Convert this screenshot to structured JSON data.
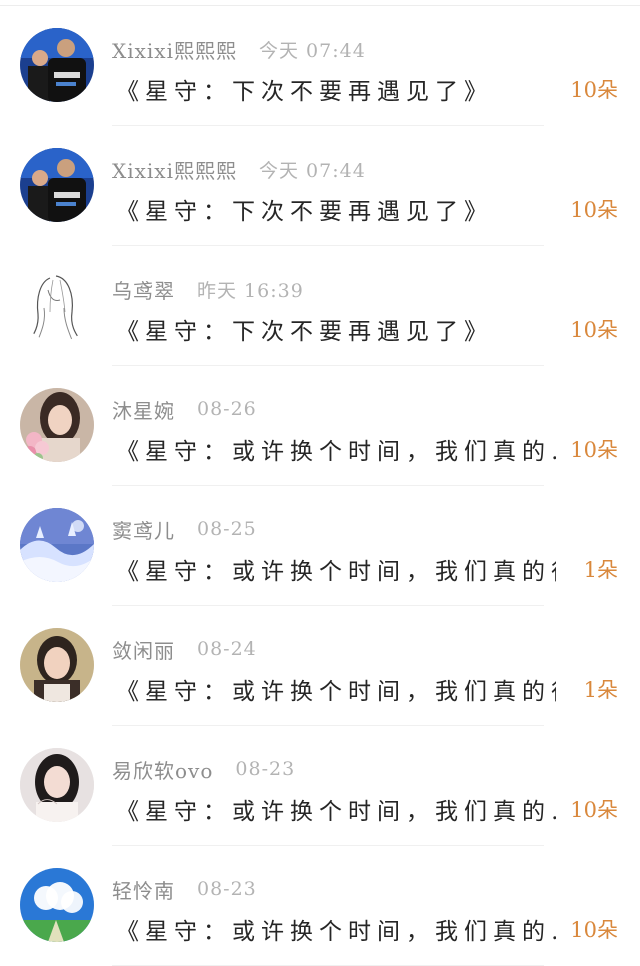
{
  "comments": [
    {
      "avatar_icon": "badminton-player-avatar",
      "username": "Xixixi熙熙熙",
      "time": "今天 07:44",
      "message": "《星守：下次不要再遇见了》",
      "count": "10朵"
    },
    {
      "avatar_icon": "badminton-player-avatar",
      "username": "Xixixi熙熙熙",
      "time": "今天 07:44",
      "message": "《星守：下次不要再遇见了》",
      "count": "10朵"
    },
    {
      "avatar_icon": "sketch-girl-avatar",
      "username": "乌鸢翠",
      "time": "昨天 16:39",
      "message": "《星守：下次不要再遇见了》",
      "count": "10朵"
    },
    {
      "avatar_icon": "girl-with-flowers-avatar",
      "username": "沐星婉",
      "time": "08-26",
      "message": "《星守：或许换个时间，我们真的…",
      "count": "10朵"
    },
    {
      "avatar_icon": "snowy-trees-avatar",
      "username": "窦鸢儿",
      "time": "08-25",
      "message": "《星守：或许换个时间，我们真的很…",
      "count": "1朵"
    },
    {
      "avatar_icon": "girl-portrait-avatar",
      "username": "敛闲丽",
      "time": "08-24",
      "message": "《星守：或许换个时间，我们真的很…",
      "count": "1朵"
    },
    {
      "avatar_icon": "dark-hair-girl-avatar",
      "username": "易欣软ovo",
      "time": "08-23",
      "message": "《星守：或许换个时间，我们真的…",
      "count": "10朵"
    },
    {
      "avatar_icon": "blue-sky-landscape-avatar",
      "username": "轻怜南",
      "time": "08-23",
      "message": "《星守：或许换个时间，我们真的…",
      "count": "10朵"
    }
  ],
  "colors": {
    "username": "#8d8d8d",
    "time": "#b3b3b3",
    "message": "#262626",
    "count": "#d9883c"
  }
}
